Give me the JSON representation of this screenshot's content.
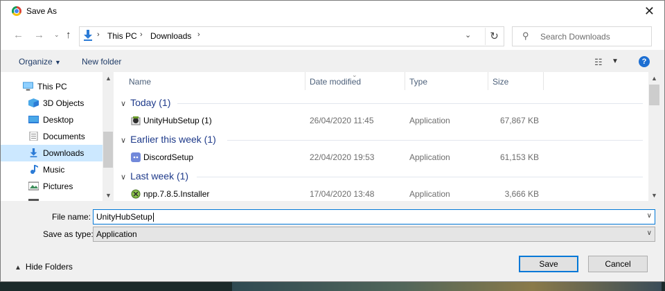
{
  "window": {
    "title": "Save As",
    "close_icon": "close-icon",
    "app_icon": "chrome-icon"
  },
  "address_bar": {
    "crumbs": [
      "This PC",
      "Downloads"
    ],
    "refresh_icon": "refresh-icon"
  },
  "search": {
    "placeholder": "Search Downloads"
  },
  "toolbar": {
    "organize": "Organize",
    "new_folder": "New folder",
    "help": "?"
  },
  "sidebar": {
    "items": [
      {
        "label": "This PC",
        "icon": "pc-icon"
      },
      {
        "label": "3D Objects",
        "icon": "3d-objects-icon"
      },
      {
        "label": "Desktop",
        "icon": "desktop-icon"
      },
      {
        "label": "Documents",
        "icon": "documents-icon"
      },
      {
        "label": "Downloads",
        "icon": "downloads-icon",
        "selected": true
      },
      {
        "label": "Music",
        "icon": "music-icon"
      },
      {
        "label": "Pictures",
        "icon": "pictures-icon"
      }
    ]
  },
  "columns": {
    "name": "Name",
    "date": "Date modified",
    "type": "Type",
    "size": "Size"
  },
  "groups": [
    {
      "label": "Today (1)",
      "files": [
        {
          "name": "UnityHubSetup (1)",
          "date": "26/04/2020 11:45",
          "type": "Application",
          "size": "67,867 KB",
          "icon": "installer-icon"
        }
      ]
    },
    {
      "label": "Earlier this week (1)",
      "files": [
        {
          "name": "DiscordSetup",
          "date": "22/04/2020 19:53",
          "type": "Application",
          "size": "61,153 KB",
          "icon": "discord-icon"
        }
      ]
    },
    {
      "label": "Last week (1)",
      "files": [
        {
          "name": "npp.7.8.5.Installer",
          "date": "17/04/2020 13:48",
          "type": "Application",
          "size": "3,666 KB",
          "icon": "npp-icon"
        }
      ]
    }
  ],
  "save": {
    "file_name_label": "File name:",
    "file_name_value": "UnityHubSetup",
    "type_label": "Save as type:",
    "type_value": "Application",
    "hide_folders": "Hide Folders",
    "save_button": "Save",
    "cancel_button": "Cancel"
  },
  "colors": {
    "accent": "#0078d7",
    "selection": "#cce8ff",
    "group_text": "#1e3a8a",
    "help_blue": "#1d6fd2"
  }
}
